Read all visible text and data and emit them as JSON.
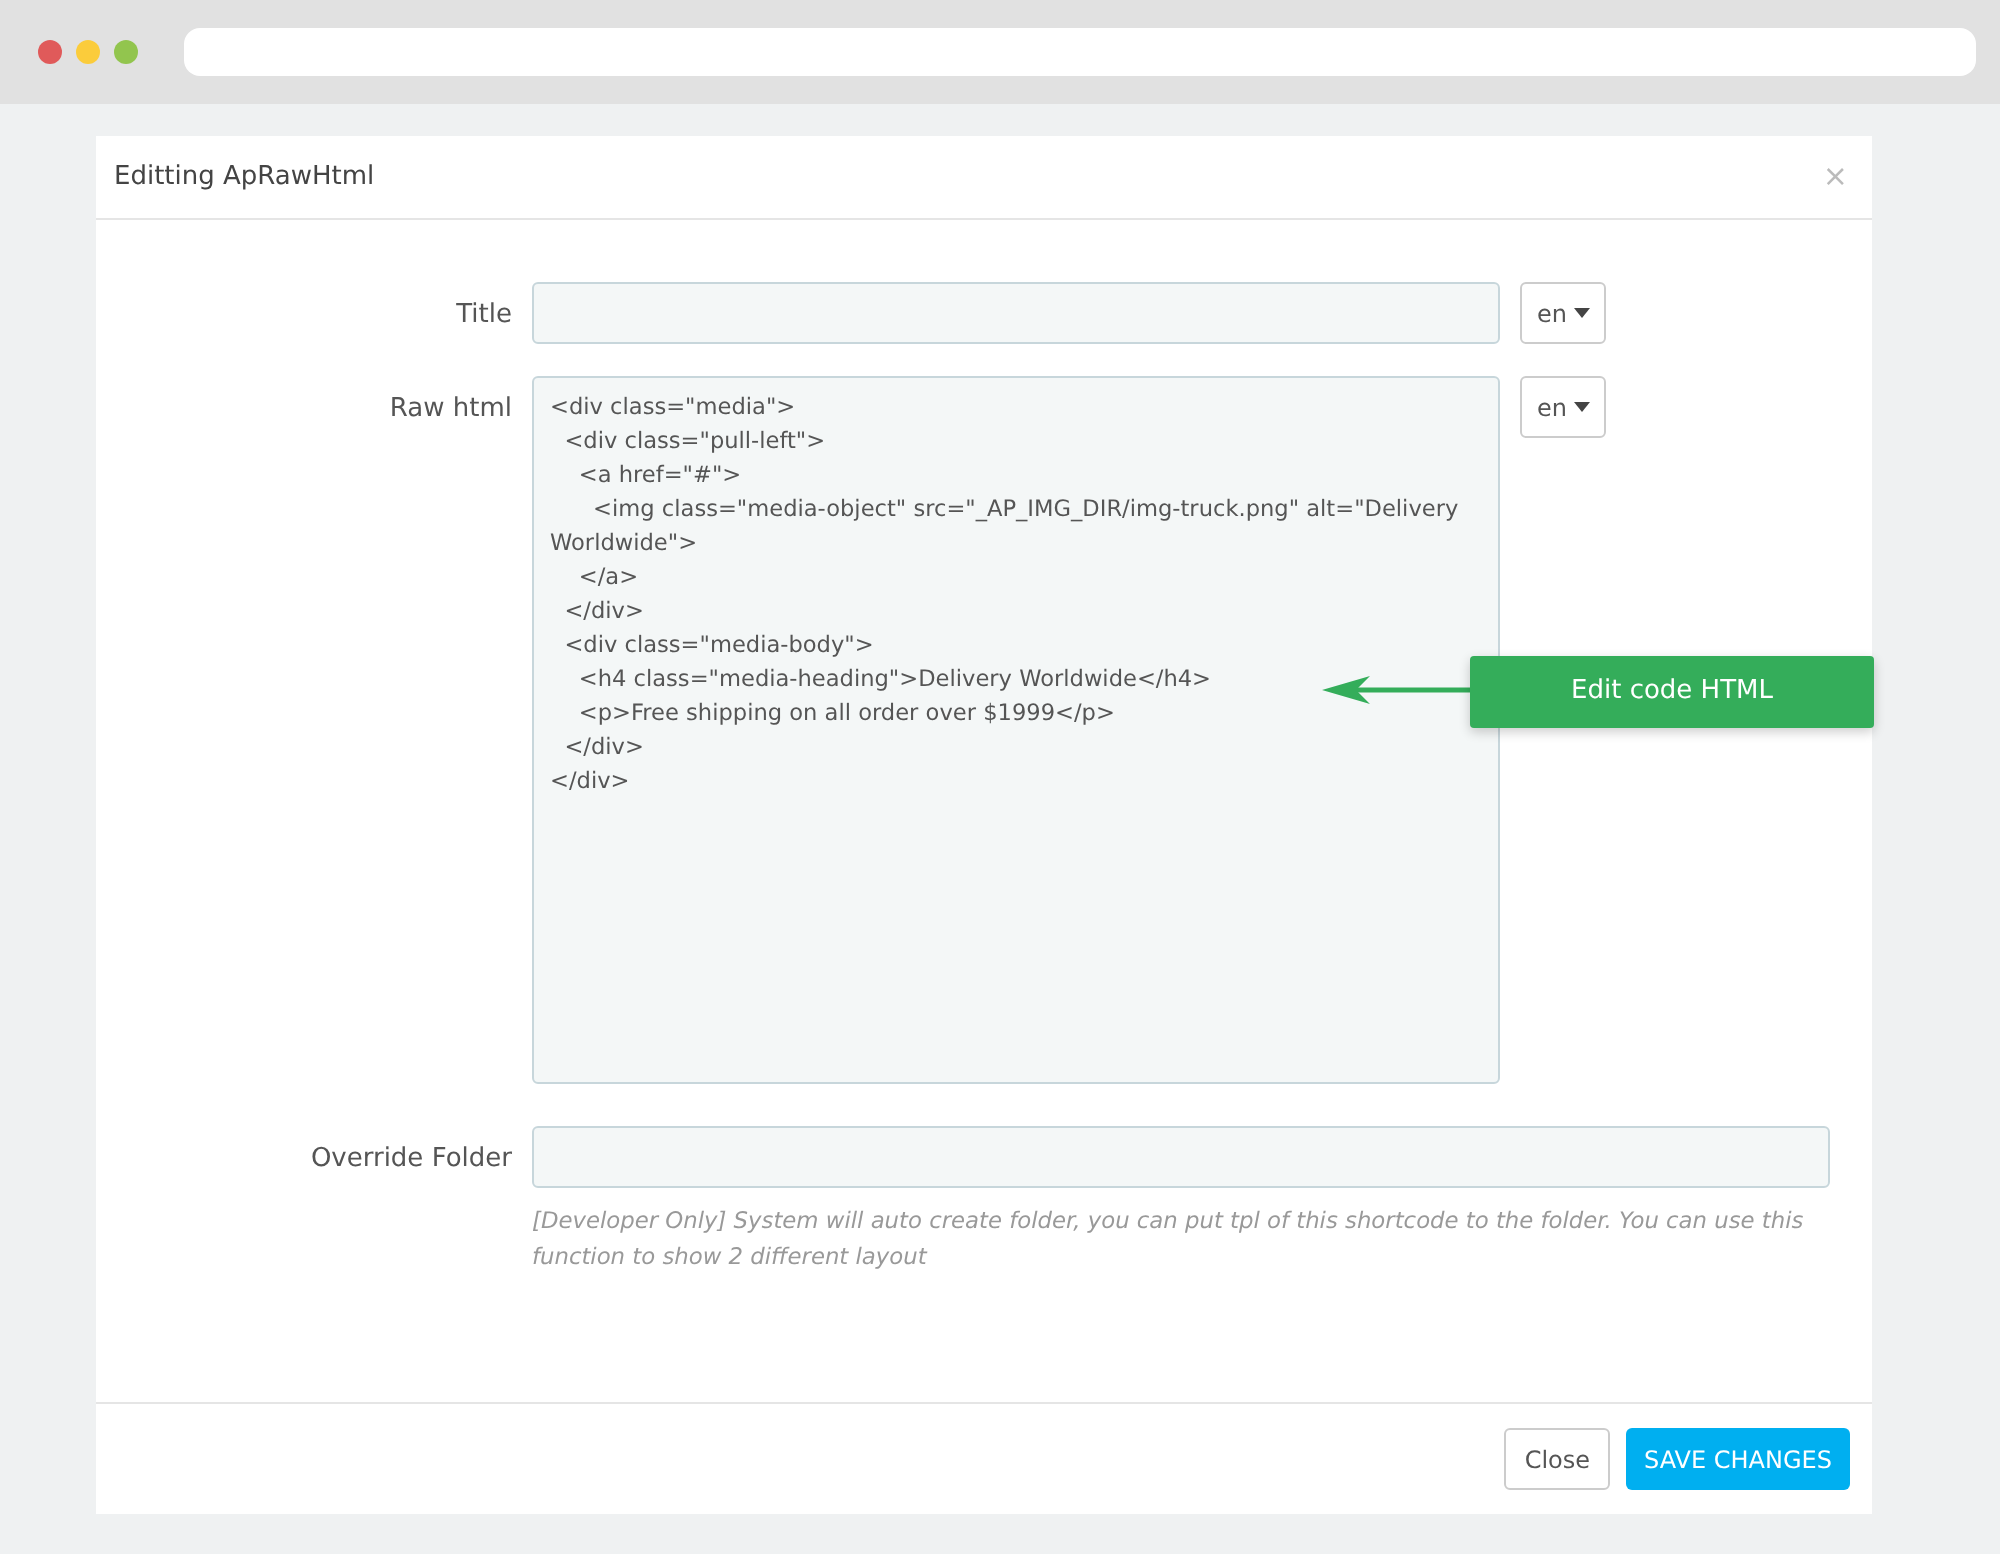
{
  "modal": {
    "title": "Editting ApRawHtml",
    "close_glyph": "×"
  },
  "fields": [
    {
      "kind": "input",
      "label": "Title",
      "language": "en"
    },
    {
      "kind": "textarea",
      "label": "Raw html",
      "value": "<div class=\"media\">\n  <div class=\"pull-left\">\n    <a href=\"#\">\n      <img class=\"media-object\" src=\"_AP_IMG_DIR/img-truck.png\" alt=\"Delivery Worldwide\">\n    </a>\n  </div>\n  <div class=\"media-body\">\n    <h4 class=\"media-heading\">Delivery Worldwide</h4>\n    <p>Free shipping on all order over $1999</p>\n  </div>\n</div>",
      "language": "en"
    },
    {
      "kind": "wide",
      "label": "Override Folder",
      "help": "[Developer Only] System will auto create folder, you can put tpl of this shortcode to the folder. You can use this function to show 2 different layout"
    }
  ],
  "callout": {
    "text": "Edit code HTML"
  },
  "buttons": [
    {
      "label": "Close",
      "kind": "secondary"
    },
    {
      "label": "SAVE CHANGES",
      "kind": "primary"
    }
  ]
}
